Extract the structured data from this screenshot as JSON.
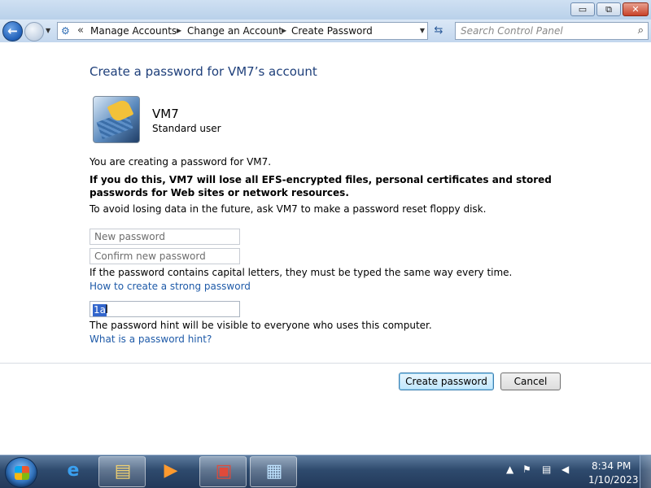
{
  "window": {
    "minimize_glyph": "▭",
    "maximize_glyph": "⧉",
    "close_glyph": "✕"
  },
  "navigation": {
    "back_glyph": "←",
    "breadcrumbs": [
      "Manage Accounts",
      "Change an Account",
      "Create Password"
    ],
    "search_placeholder": "Search Control Panel"
  },
  "page": {
    "title": "Create a password for VM7’s account",
    "user": {
      "name": "VM7",
      "type": "Standard user"
    },
    "intro": "You are creating a password for VM7.",
    "warning": "If you do this, VM7 will lose all EFS-encrypted files, personal certificates and stored passwords for Web sites or network resources.",
    "advice": "To avoid losing data in the future, ask VM7 to make a password reset floppy disk.",
    "new_password_placeholder": "New password",
    "confirm_password_placeholder": "Confirm new password",
    "case_note": "If the password contains capital letters, they must be typed the same way every time.",
    "strong_password_link": "How to create a strong password",
    "hint_value": "1a",
    "hint_note": "The password hint will be visible to everyone who uses this computer.",
    "hint_link": "What is a password hint?",
    "create_button": "Create password",
    "cancel_button": "Cancel"
  },
  "taskbar": {
    "pinned": [
      "internet-explorer-icon",
      "windows-explorer-icon",
      "media-player-icon",
      "toolbox-icon",
      "control-panel-icon"
    ],
    "clock_time": "8:34 PM",
    "clock_date": "1/10/2023"
  },
  "colors": {
    "title_blue": "#1e3f7a",
    "link_blue": "#1e5aa8",
    "taskbar": "#2e4a6d"
  }
}
